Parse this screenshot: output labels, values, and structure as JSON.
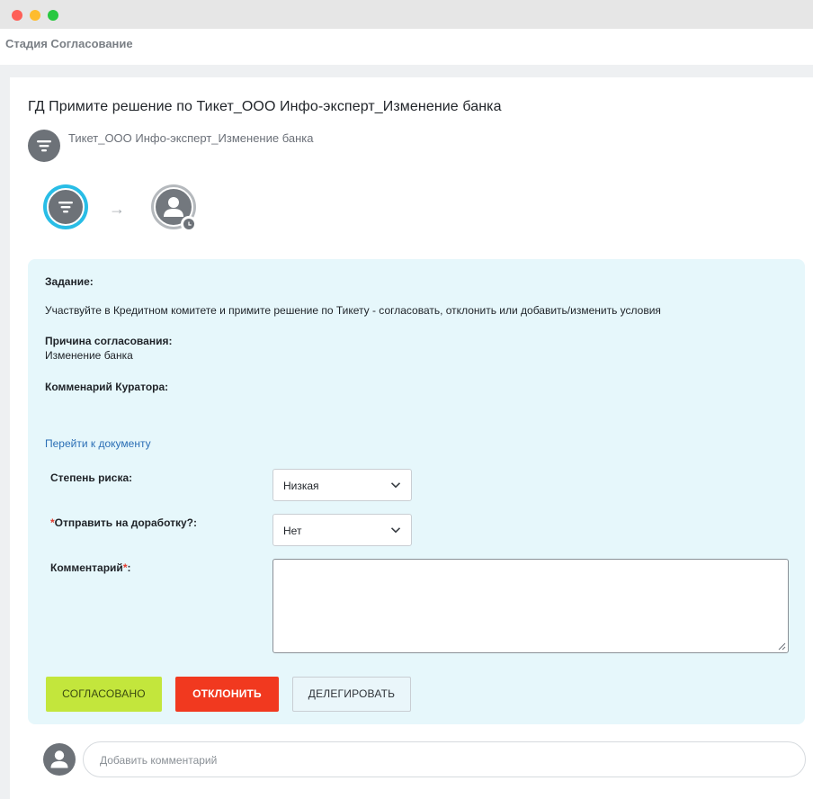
{
  "window": {
    "stage_title": "Стадия Согласование"
  },
  "task": {
    "title": "ГД Примите решение по Тикет_ООО Инфо-эксперт_Изменение банка",
    "subtitle": "Тикет_ООО Инфо-эксперт_Изменение банка",
    "flow_arrow": "→"
  },
  "panel": {
    "assignment_label": "Задание:",
    "assignment_text": "Участвуйте в Кредитном комитете и примите решение по Тикету - согласовать, отклонить или добавить/изменить условия",
    "reason_label": "Причина согласования:",
    "reason_value": "Изменение банка",
    "curator_comment_label": "Комменарий Куратора:",
    "document_link": "Перейти к документу"
  },
  "form": {
    "risk_label": "Степень риска:",
    "risk_value": "Низкая",
    "rework_required_mark": "*",
    "rework_label": "Отправить на доработку?:",
    "rework_value": "Нет",
    "comment_label": "Комментарий",
    "comment_required_mark": "*",
    "comment_suffix": ":"
  },
  "buttons": {
    "approve": "СОГЛАСОВАНО",
    "reject": "ОТКЛОНИТЬ",
    "delegate": "ДЕЛЕГИРОВАТЬ"
  },
  "comments": {
    "placeholder": "Добавить комментарий"
  },
  "colors": {
    "accent_ring": "#29bde6",
    "approve": "#c3e63c",
    "reject": "#f1391f",
    "panel_bg": "#e6f7fb",
    "link": "#2a6eb5"
  },
  "icons": {
    "task_icon": "filter-icon",
    "assignee_icon": "user-icon",
    "status_icon": "clock-icon",
    "dropdown_icon": "chevron-down-icon"
  }
}
